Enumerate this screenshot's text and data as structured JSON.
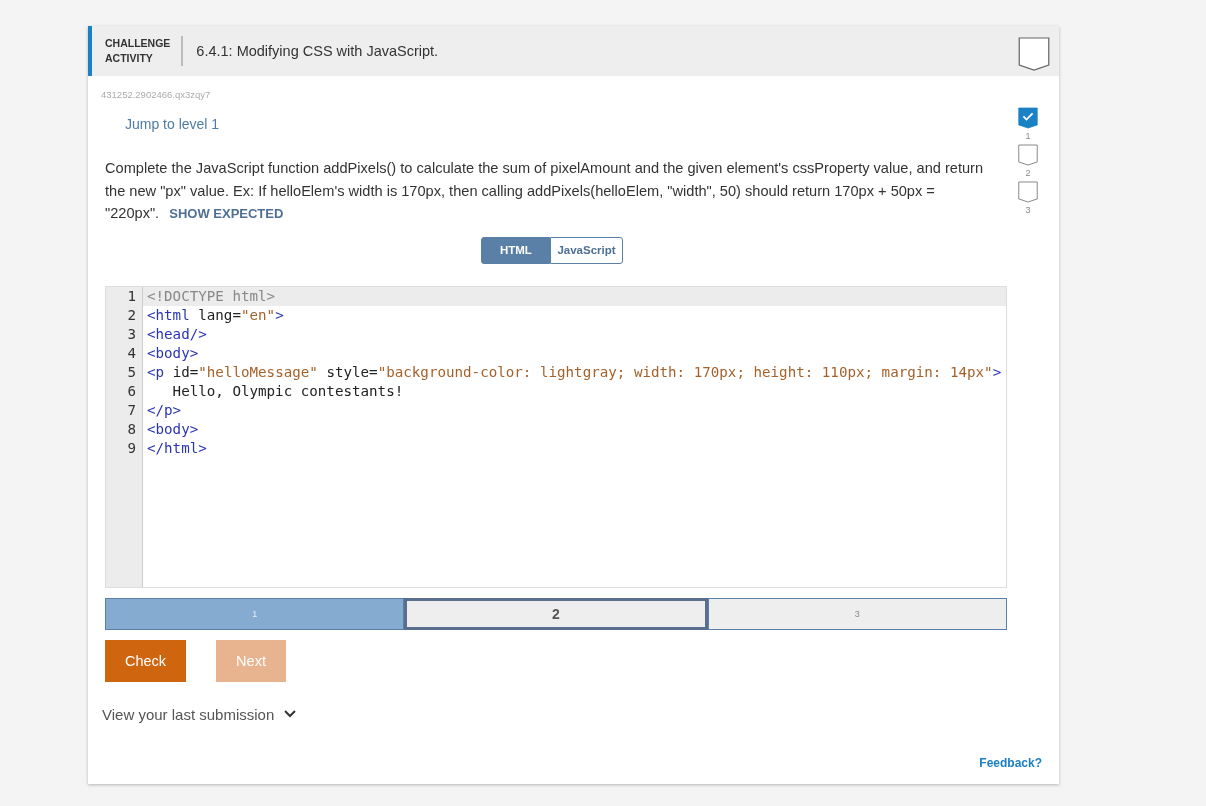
{
  "header": {
    "badge_line_1": "CHALLENGE",
    "badge_line_2": "ACTIVITY",
    "title": "6.4.1: Modifying CSS with JavaScript.",
    "completed": false
  },
  "activity_id": "431252.2902466.qx3zqy7",
  "jump_link": "Jump to level 1",
  "instructions": "Complete the JavaScript function addPixels() to calculate the sum of pixelAmount and the given element's cssProperty value, and return the new \"px\" value. Ex: If helloElem's width is 170px, then calling addPixels(helloElem, \"width\", 50) should return 170px + 50px = \"220px\".",
  "show_expected": "SHOW EXPECTED",
  "tabs": [
    {
      "label": "HTML",
      "selected": true
    },
    {
      "label": "JavaScript",
      "selected": false
    }
  ],
  "code_lines": [
    {
      "number": "1",
      "selected": true,
      "tokens": [
        {
          "kind": "doctype",
          "text": "<!DOCTYPE html>"
        }
      ]
    },
    {
      "number": "2",
      "selected": false,
      "tokens": [
        {
          "kind": "tag",
          "text": "<html "
        },
        {
          "kind": "attr",
          "text": "lang"
        },
        {
          "kind": "plain",
          "text": "="
        },
        {
          "kind": "string",
          "text": "\"en\""
        },
        {
          "kind": "tag",
          "text": ">"
        }
      ]
    },
    {
      "number": "3",
      "selected": false,
      "tokens": [
        {
          "kind": "tag",
          "text": "<head/>"
        }
      ]
    },
    {
      "number": "4",
      "selected": false,
      "tokens": [
        {
          "kind": "tag",
          "text": "<body>"
        }
      ]
    },
    {
      "number": "5",
      "selected": false,
      "tokens": [
        {
          "kind": "tag",
          "text": "<p "
        },
        {
          "kind": "attr",
          "text": "id"
        },
        {
          "kind": "plain",
          "text": "="
        },
        {
          "kind": "string",
          "text": "\"helloMessage\""
        },
        {
          "kind": "attr",
          "text": " style"
        },
        {
          "kind": "plain",
          "text": "="
        },
        {
          "kind": "string",
          "text": "\"background-color: lightgray; width: 170px; height: 110px; margin: 14px\""
        },
        {
          "kind": "tag",
          "text": ">"
        }
      ]
    },
    {
      "number": "6",
      "selected": false,
      "tokens": [
        {
          "kind": "plain",
          "text": "   Hello, Olympic contestants!"
        }
      ]
    },
    {
      "number": "7",
      "selected": false,
      "tokens": [
        {
          "kind": "tag",
          "text": "</p>"
        }
      ]
    },
    {
      "number": "8",
      "selected": false,
      "tokens": [
        {
          "kind": "tag",
          "text": "<body>"
        }
      ]
    },
    {
      "number": "9",
      "selected": false,
      "tokens": [
        {
          "kind": "tag",
          "text": "</html>"
        }
      ]
    }
  ],
  "progress_segments": [
    {
      "label": "1",
      "completed": true,
      "selected": false
    },
    {
      "label": "2",
      "completed": false,
      "selected": true
    },
    {
      "label": "3",
      "completed": false,
      "selected": false
    }
  ],
  "buttons": [
    {
      "label": "Check",
      "disabled": false
    },
    {
      "label": "Next",
      "disabled": true
    }
  ],
  "last_submission": "View your last submission",
  "level_marks": [
    {
      "label": "1",
      "checked": true
    },
    {
      "label": "2",
      "checked": false
    },
    {
      "label": "3",
      "checked": false
    }
  ],
  "feedback_link": "Feedback?"
}
